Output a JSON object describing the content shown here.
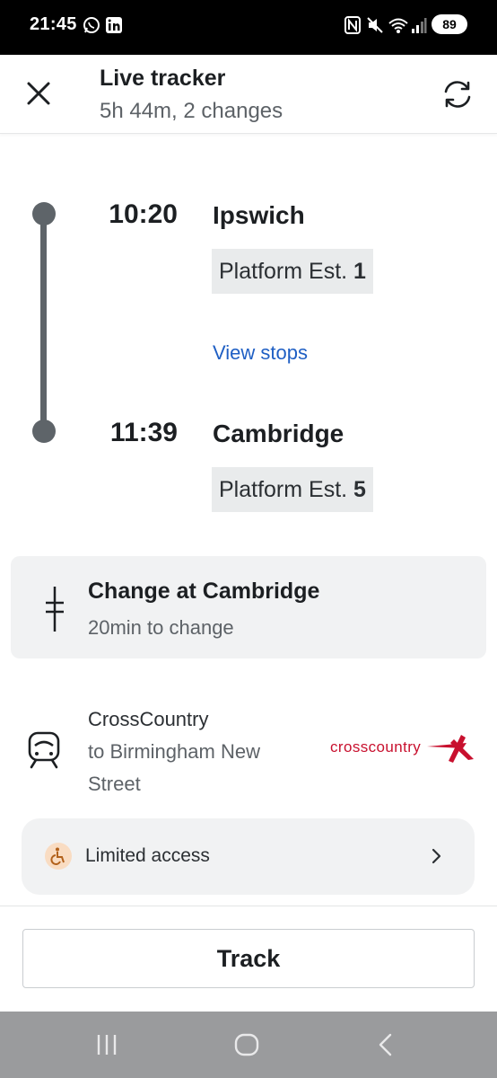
{
  "status_bar": {
    "time": "21:45",
    "battery": "89",
    "icons": [
      "whatsapp-icon",
      "linkedin-icon",
      "nfc-icon",
      "mute-icon",
      "wifi-icon",
      "signal-icon"
    ]
  },
  "header": {
    "title": "Live tracker",
    "subtitle": "5h 44m, 2 changes"
  },
  "journey": {
    "departure": {
      "time": "10:20",
      "station": "Ipswich",
      "platform_prefix": "Platform Est.",
      "platform_number": "1"
    },
    "view_stops": "View stops",
    "arrival": {
      "time": "11:39",
      "station": "Cambridge",
      "platform_prefix": "Platform Est.",
      "platform_number": "5"
    }
  },
  "change": {
    "title": "Change at Cambridge",
    "subtitle": "20min to change"
  },
  "operator": {
    "name": "CrossCountry",
    "destination": "to Birmingham New Street",
    "logo_text": "crosscountry"
  },
  "access": {
    "label": "Limited access"
  },
  "actions": {
    "track_label": "Track"
  },
  "colors": {
    "link": "#1f5fc4",
    "timeline": "#5e6469",
    "brand_red": "#c8102e",
    "access_bg": "#f9dcc2"
  }
}
